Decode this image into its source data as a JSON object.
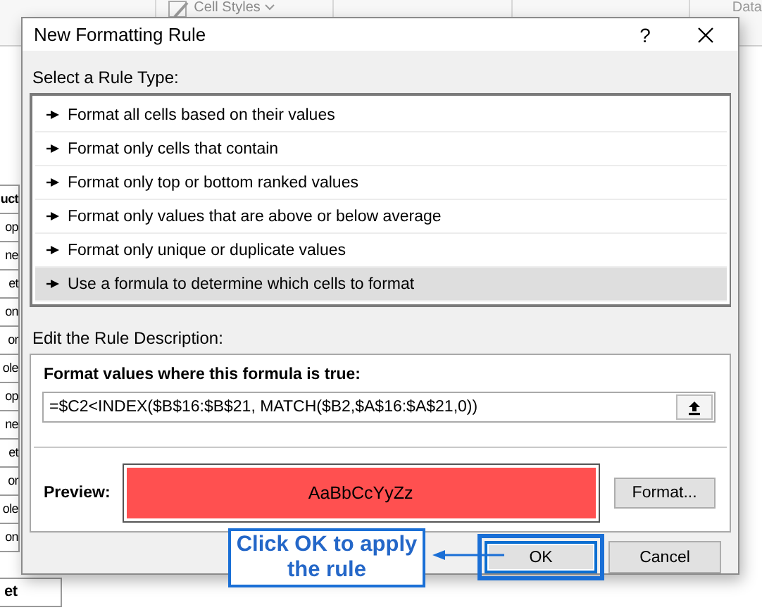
{
  "ribbon": {
    "cell_styles": "Cell Styles",
    "tab": "Data"
  },
  "sheet": {
    "cells": [
      {
        "text": "uct",
        "bold": true
      },
      {
        "text": "op",
        "bold": false
      },
      {
        "text": "ne",
        "bold": false
      },
      {
        "text": "et",
        "bold": false
      },
      {
        "text": "on",
        "bold": false
      },
      {
        "text": "or",
        "bold": false
      },
      {
        "text": "ole",
        "bold": false
      },
      {
        "text": "op",
        "bold": false
      },
      {
        "text": "ne",
        "bold": false
      },
      {
        "text": "et",
        "bold": false
      },
      {
        "text": "or",
        "bold": false
      },
      {
        "text": "ole",
        "bold": false
      },
      {
        "text": "on",
        "bold": false
      }
    ],
    "footer_cell": {
      "text": "et",
      "bold": true
    }
  },
  "dialog": {
    "title": "New Formatting Rule",
    "help": "?",
    "rule_type_label": "Select a Rule Type:",
    "rule_types": [
      {
        "label": "Format all cells based on their values",
        "selected": false
      },
      {
        "label": "Format only cells that contain",
        "selected": false
      },
      {
        "label": "Format only top or bottom ranked values",
        "selected": false
      },
      {
        "label": "Format only values that are above or below average",
        "selected": false
      },
      {
        "label": "Format only unique or duplicate values",
        "selected": false
      },
      {
        "label": "Use a formula to determine which cells to format",
        "selected": true
      }
    ],
    "description_label": "Edit the Rule Description:",
    "formula_label": "Format values where this formula is true:",
    "formula": "=$C2<INDEX($B$16:$B$21, MATCH($B2,$A$16:$A$21,0))",
    "preview_label": "Preview:",
    "preview_text": "AaBbCcYyZz",
    "format_button": "Format...",
    "buttons": [
      {
        "label": "OK",
        "kind": "default"
      },
      {
        "label": "Cancel",
        "kind": "normal"
      }
    ]
  },
  "callout": {
    "text": "Click OK to apply the rule"
  }
}
